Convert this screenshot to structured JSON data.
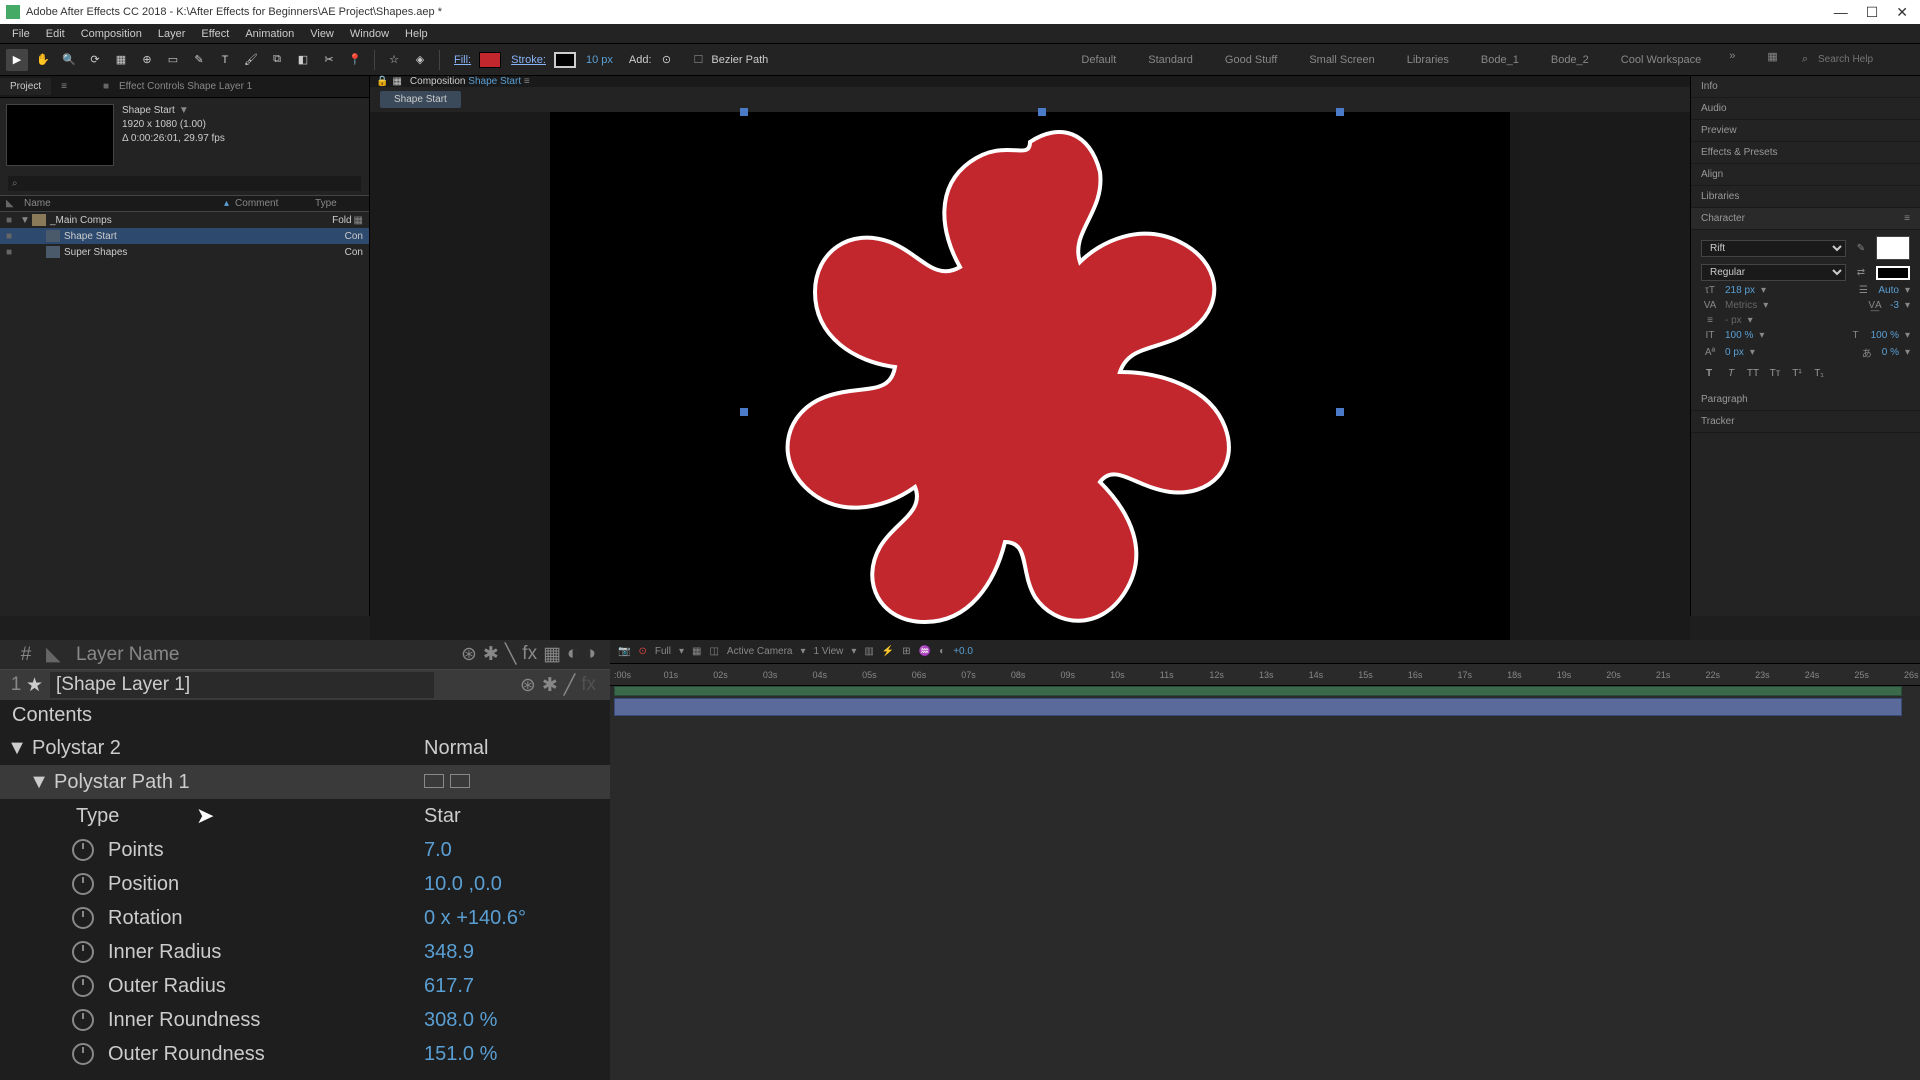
{
  "titlebar": {
    "text": "Adobe After Effects CC 2018 - K:\\After Effects for Beginners\\AE Project\\Shapes.aep *"
  },
  "menu": [
    "File",
    "Edit",
    "Composition",
    "Layer",
    "Effect",
    "Animation",
    "View",
    "Window",
    "Help"
  ],
  "toolbar": {
    "fill_label": "Fill:",
    "stroke_label": "Stroke:",
    "stroke_px": "10 px",
    "add_label": "Add:",
    "bezier_label": "Bezier Path"
  },
  "workspaces": [
    "Default",
    "Standard",
    "Good Stuff",
    "Small Screen",
    "Libraries",
    "Bode_1",
    "Bode_2",
    "Cool Workspace"
  ],
  "search_help_placeholder": "Search Help",
  "project": {
    "tab_project": "Project",
    "tab_effect": "Effect Controls Shape Layer 1",
    "thumb_title": "Shape Start",
    "thumb_res": "1920 x 1080 (1.00)",
    "thumb_dur": "Δ 0:00:26:01, 29.97 fps",
    "col_name": "Name",
    "col_comment": "Comment",
    "col_type": "Type",
    "folder": "_Main Comps",
    "folder_type": "Fold",
    "comp1": "Shape Start",
    "comp1_type": "Con",
    "comp2": "Super Shapes",
    "comp2_type": "Con"
  },
  "viewer": {
    "comp_label": "Composition",
    "comp_name": "Shape Start",
    "flow_chip": "Shape Start",
    "controls": {
      "res": "Full",
      "camera": "Active Camera",
      "views": "1 View",
      "exposure": "+0.0"
    }
  },
  "right_panels": [
    "Info",
    "Audio",
    "Preview",
    "Effects & Presets",
    "Align",
    "Libraries",
    "Character",
    "Paragraph",
    "Tracker"
  ],
  "character": {
    "font": "Rift",
    "weight": "Regular",
    "size": "218 px",
    "leading": "Auto",
    "kerning": "Metrics",
    "tracking": "-3",
    "stroke_width": "- px",
    "vscale": "100 %",
    "hscale": "100 %",
    "baseline": "0 px",
    "tsume": "0 %"
  },
  "layer_panel": {
    "col_hash": "#",
    "col_name": "Layer Name",
    "layer_num": "1",
    "layer_name": "Shape Layer 1",
    "contents": "Contents",
    "polystar2": "Polystar 2",
    "polystar2_mode": "Normal",
    "path1": "Polystar Path 1",
    "props": {
      "type_label": "Type",
      "type_value": "Star",
      "points_label": "Points",
      "points_value": "7.0",
      "position_label": "Position",
      "position_value": "10.0 ,0.0",
      "rotation_label": "Rotation",
      "rotation_value": "0 x +140.6°",
      "inner_radius_label": "Inner Radius",
      "inner_radius_value": "348.9",
      "outer_radius_label": "Outer Radius",
      "outer_radius_value": "617.7",
      "inner_round_label": "Inner Roundness",
      "inner_round_value": "308.0 %",
      "outer_round_label": "Outer Roundness",
      "outer_round_value": "151.0 %"
    }
  },
  "timeline": {
    "ticks": [
      ":00s",
      "01s",
      "02s",
      "03s",
      "04s",
      "05s",
      "06s",
      "07s",
      "08s",
      "09s",
      "10s",
      "11s",
      "12s",
      "13s",
      "14s",
      "15s",
      "16s",
      "17s",
      "18s",
      "19s",
      "20s",
      "21s",
      "22s",
      "23s",
      "24s",
      "25s",
      "26s"
    ]
  }
}
